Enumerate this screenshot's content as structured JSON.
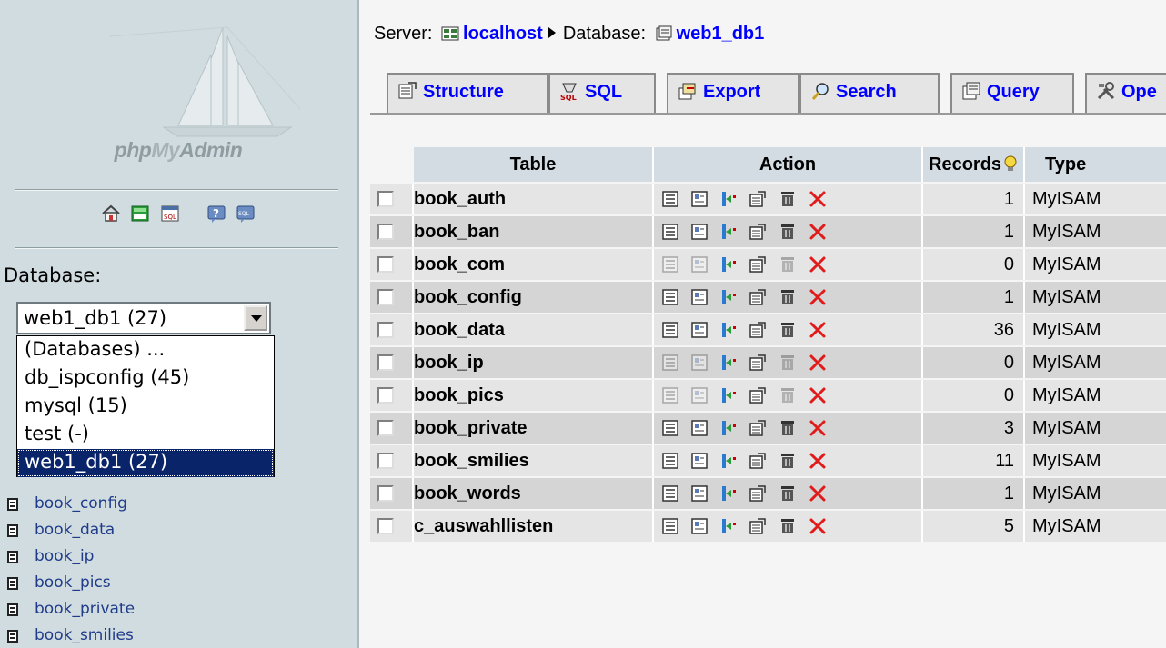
{
  "left": {
    "logo": {
      "text_php": "php",
      "text_my": "My",
      "text_admin": "Admin"
    },
    "toolbar_icons": [
      "home-icon",
      "exit-icon",
      "sql-query-icon",
      "help-icon",
      "sql-docs-icon"
    ],
    "database_label": "Database:",
    "database_select_value": "web1_db1 (27)",
    "database_options": [
      {
        "label": "(Databases) ...",
        "selected": false
      },
      {
        "label": "db_ispconfig (45)",
        "selected": false
      },
      {
        "label": "mysql (15)",
        "selected": false
      },
      {
        "label": "test (-)",
        "selected": false
      },
      {
        "label": "web1_db1 (27)",
        "selected": true
      }
    ],
    "table_links": [
      "book_config",
      "book_data",
      "book_ip",
      "book_pics",
      "book_private",
      "book_smilies"
    ]
  },
  "main": {
    "breadcrumb": {
      "server_label": "Server:",
      "server_value": "localhost",
      "database_label": "Database:",
      "database_value": "web1_db1"
    },
    "tabs": [
      {
        "label": "Structure",
        "icon": "structure-icon"
      },
      {
        "label": "SQL",
        "icon": "sql-icon"
      },
      {
        "label": "Export",
        "icon": "export-icon"
      },
      {
        "label": "Search",
        "icon": "search-icon"
      },
      {
        "label": "Query",
        "icon": "query-icon"
      },
      {
        "label": "Ope",
        "icon": "operations-icon"
      }
    ],
    "table_headers": {
      "table": "Table",
      "action": "Action",
      "records": "Records",
      "type": "Type"
    },
    "rows": [
      {
        "name": "book_auth",
        "records": "1",
        "type": "MyISAM",
        "empty": false
      },
      {
        "name": "book_ban",
        "records": "1",
        "type": "MyISAM",
        "empty": false
      },
      {
        "name": "book_com",
        "records": "0",
        "type": "MyISAM",
        "empty": true
      },
      {
        "name": "book_config",
        "records": "1",
        "type": "MyISAM",
        "empty": false
      },
      {
        "name": "book_data",
        "records": "36",
        "type": "MyISAM",
        "empty": false
      },
      {
        "name": "book_ip",
        "records": "0",
        "type": "MyISAM",
        "empty": true
      },
      {
        "name": "book_pics",
        "records": "0",
        "type": "MyISAM",
        "empty": true
      },
      {
        "name": "book_private",
        "records": "3",
        "type": "MyISAM",
        "empty": false
      },
      {
        "name": "book_smilies",
        "records": "11",
        "type": "MyISAM",
        "empty": false
      },
      {
        "name": "book_words",
        "records": "1",
        "type": "MyISAM",
        "empty": false
      },
      {
        "name": "c_auswahllisten",
        "records": "5",
        "type": "MyISAM",
        "empty": false
      }
    ],
    "colors": {
      "link": "#0000ff",
      "header_bg": "#d3dce3",
      "row_odd": "#e5e5e5",
      "row_even": "#d5d5d5",
      "drop_red": "#e01b1b"
    }
  }
}
